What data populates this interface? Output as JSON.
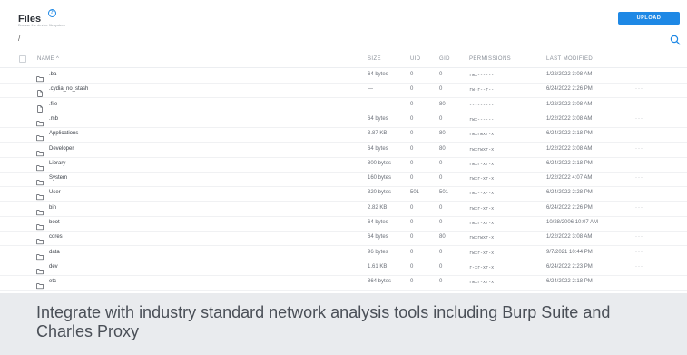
{
  "header": {
    "title": "Files",
    "subtitle": "Browse the device filesystem",
    "path": "/",
    "upload_label": "UPLOAD"
  },
  "icons": {
    "info": "info-circle-icon",
    "search": "search-icon",
    "folder": "folder-icon",
    "file": "file-icon",
    "more": "more-horizontal-icon"
  },
  "colors": {
    "accent": "#1e88e5",
    "background": "#e9ebee",
    "panel": "#ffffff"
  },
  "table": {
    "columns": [
      "NAME ^",
      "SIZE",
      "UID",
      "GID",
      "PERMISSIONS",
      "LAST MODIFIED"
    ],
    "rows": [
      {
        "type": "folder",
        "name": ".ba",
        "size": "64 bytes",
        "uid": "0",
        "gid": "0",
        "perm": "rwx------",
        "modified": "1/22/2022 3:08 AM",
        "more": "···"
      },
      {
        "type": "file",
        "name": ".cydia_no_stash",
        "size": "—",
        "uid": "0",
        "gid": "0",
        "perm": "rw-r--r--",
        "modified": "6/24/2022 2:26 PM",
        "more": "···"
      },
      {
        "type": "file",
        "name": ".file",
        "size": "—",
        "uid": "0",
        "gid": "80",
        "perm": "---------",
        "modified": "1/22/2022 3:08 AM",
        "more": "···"
      },
      {
        "type": "folder",
        "name": ".mb",
        "size": "64 bytes",
        "uid": "0",
        "gid": "0",
        "perm": "rwx------",
        "modified": "1/22/2022 3:08 AM",
        "more": "···"
      },
      {
        "type": "folder",
        "name": "Applications",
        "size": "3.87 KB",
        "uid": "0",
        "gid": "80",
        "perm": "rwxrwxr-x",
        "modified": "6/24/2022 2:18 PM",
        "more": "···"
      },
      {
        "type": "folder",
        "name": "Developer",
        "size": "64 bytes",
        "uid": "0",
        "gid": "80",
        "perm": "rwxrwxr-x",
        "modified": "1/22/2022 3:08 AM",
        "more": "···"
      },
      {
        "type": "folder",
        "name": "Library",
        "size": "800 bytes",
        "uid": "0",
        "gid": "0",
        "perm": "rwxr-xr-x",
        "modified": "6/24/2022 2:18 PM",
        "more": "···"
      },
      {
        "type": "folder",
        "name": "System",
        "size": "160 bytes",
        "uid": "0",
        "gid": "0",
        "perm": "rwxr-xr-x",
        "modified": "1/22/2022 4:07 AM",
        "more": "···"
      },
      {
        "type": "folder",
        "name": "User",
        "size": "320 bytes",
        "uid": "501",
        "gid": "501",
        "perm": "rwx--x--x",
        "modified": "6/24/2022 2:28 PM",
        "more": "···"
      },
      {
        "type": "folder",
        "name": "bin",
        "size": "2.82 KB",
        "uid": "0",
        "gid": "0",
        "perm": "rwxr-xr-x",
        "modified": "6/24/2022 2:26 PM",
        "more": "···"
      },
      {
        "type": "folder",
        "name": "boot",
        "size": "64 bytes",
        "uid": "0",
        "gid": "0",
        "perm": "rwxr-xr-x",
        "modified": "10/28/2006 10:07 AM",
        "more": "···"
      },
      {
        "type": "folder",
        "name": "cores",
        "size": "64 bytes",
        "uid": "0",
        "gid": "80",
        "perm": "rwxrwxr-x",
        "modified": "1/22/2022 3:08 AM",
        "more": "···"
      },
      {
        "type": "folder",
        "name": "data",
        "size": "96 bytes",
        "uid": "0",
        "gid": "0",
        "perm": "rwxr-xr-x",
        "modified": "9/7/2021 10:44 PM",
        "more": "···"
      },
      {
        "type": "folder",
        "name": "dev",
        "size": "1.61 KB",
        "uid": "0",
        "gid": "0",
        "perm": "r-xr-xr-x",
        "modified": "6/24/2022 2:23 PM",
        "more": "···"
      },
      {
        "type": "folder",
        "name": "etc",
        "size": "864 bytes",
        "uid": "0",
        "gid": "0",
        "perm": "rwxr-xr-x",
        "modified": "6/24/2022 2:18 PM",
        "more": "···"
      }
    ]
  },
  "caption": "Integrate with industry standard network analysis tools including Burp Suite and Charles Proxy"
}
